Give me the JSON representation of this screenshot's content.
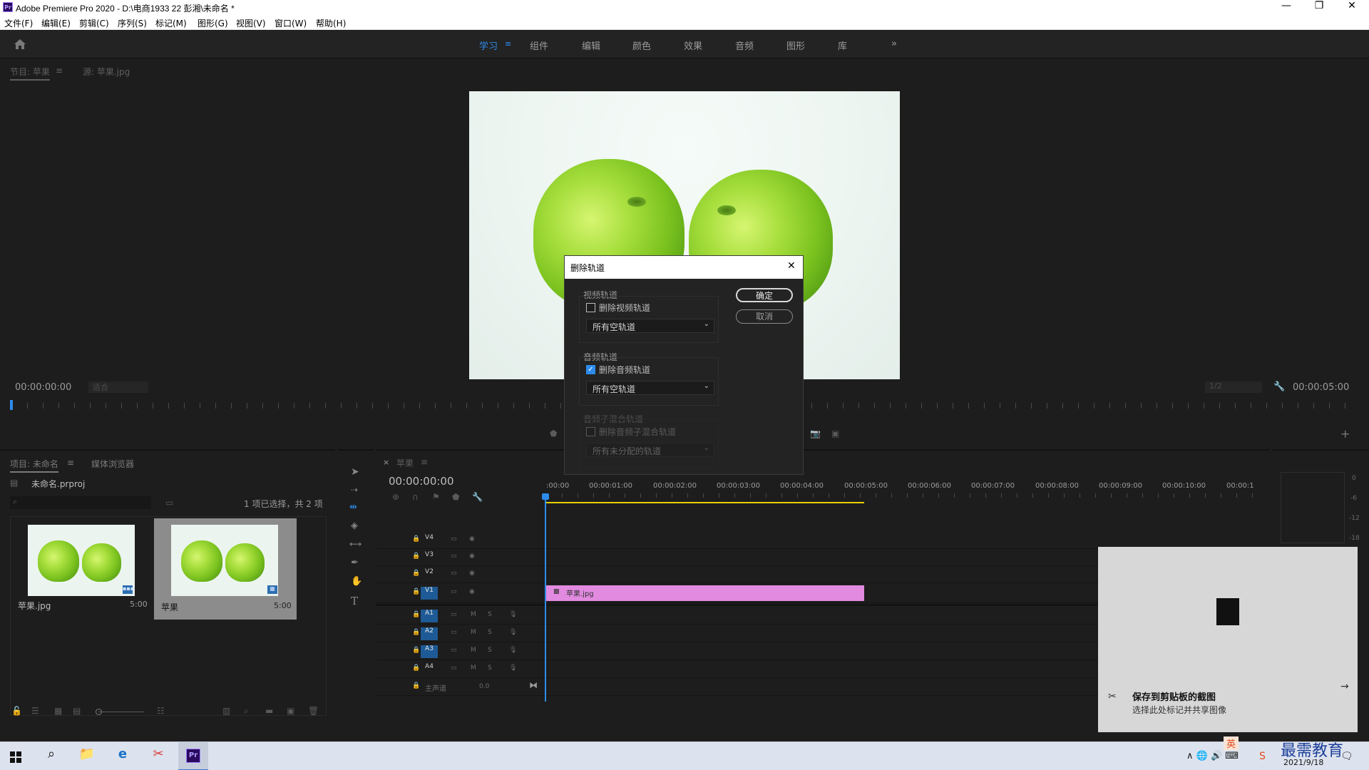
{
  "window": {
    "app_icon": "Pr",
    "title": "Adobe Premiere Pro 2020 - D:\\电商1933 22 彭湘\\未命名 *",
    "minimize": "—",
    "maximize": "❐",
    "close": "✕"
  },
  "menu": [
    "文件(F)",
    "编辑(E)",
    "剪辑(C)",
    "序列(S)",
    "标记(M)",
    "图形(G)",
    "视图(V)",
    "窗口(W)",
    "帮助(H)"
  ],
  "workspaces": {
    "tabs": [
      "学习",
      "组件",
      "编辑",
      "颜色",
      "效果",
      "音频",
      "图形",
      "库"
    ],
    "active": "学习",
    "overflow": "»"
  },
  "monitor": {
    "tab_program": "节目: 苹果",
    "tab_source": "源: 苹果.jpg",
    "timecode_in": "00:00:00:00",
    "fit": "适合",
    "resolution": "1/2",
    "timecode_out": "00:00:05:00"
  },
  "project": {
    "tab_project": "项目: 未命名",
    "tab_media": "媒体浏览器",
    "file": "未命名.prproj",
    "selection": "1 项已选择，共 2 项",
    "items": [
      {
        "name": "苹果.jpg",
        "duration": "5:00"
      },
      {
        "name": "苹果",
        "duration": "5:00"
      }
    ]
  },
  "timeline": {
    "close": "×",
    "tab": "苹果",
    "timecode": "00:00:00:00",
    "ruler": [
      ":00:00",
      "00:00:01:00",
      "00:00:02:00",
      "00:00:03:00",
      "00:00:04:00",
      "00:00:05:00",
      "00:00:06:00",
      "00:00:07:00",
      "00:00:08:00",
      "00:00:09:00",
      "00:00:10:00",
      "00:00:1"
    ],
    "video_tracks": [
      "V4",
      "V3",
      "V2",
      "V1"
    ],
    "audio_tracks": [
      "A1",
      "A2",
      "A3",
      "A4"
    ],
    "master": "主声道",
    "master_value": "0.0",
    "clip": "苹果.jpg",
    "clip_color": "#e28ae0"
  },
  "meter": {
    "scale": [
      "0",
      "-6",
      "-12",
      "-18"
    ]
  },
  "dialog": {
    "title": "删除轨道",
    "close": "✕",
    "video_group": "视频轨道",
    "video_checkbox": "删除视频轨道",
    "video_checked": false,
    "video_select": "所有空轨道",
    "audio_group": "音频轨道",
    "audio_checkbox": "删除音频轨道",
    "audio_checked": true,
    "audio_select": "所有空轨道",
    "submix_group": "音频子混合轨道",
    "submix_checkbox": "删除音频子混合轨道",
    "submix_select": "所有未分配的轨道",
    "ok": "确定",
    "cancel": "取消"
  },
  "toast": {
    "title": "保存到剪贴板的截图",
    "subtitle": "选择此处标记并共享图像",
    "arrow": "→"
  },
  "taskbar": {
    "date": "2021/9/18",
    "watermark": "最需教育",
    "ime": "英",
    "tray": "∧ 🌐 🔊 ⌨"
  }
}
